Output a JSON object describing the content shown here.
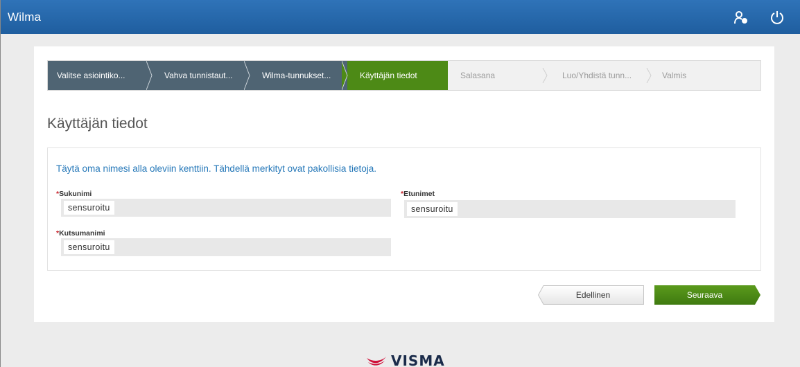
{
  "app": {
    "title": "Wilma"
  },
  "topbar": {
    "user_icon": "user-settings-icon",
    "power_icon": "power-icon"
  },
  "stepper": {
    "steps": [
      {
        "label": "Valitse asiointiko...",
        "state": "done"
      },
      {
        "label": "Vahva tunnistaut...",
        "state": "done"
      },
      {
        "label": "Wilma-tunnukset...",
        "state": "done"
      },
      {
        "label": "Käyttäjän tiedot",
        "state": "active"
      },
      {
        "label": "Salasana",
        "state": "todo"
      },
      {
        "label": "Luo/Yhdistä tunn...",
        "state": "todo"
      },
      {
        "label": "Valmis",
        "state": "todo"
      }
    ]
  },
  "page": {
    "title": "Käyttäjän tiedot",
    "instruction": "Täytä oma nimesi alla oleviin kenttiin. Tähdellä merkityt ovat pakollisia tietoja."
  },
  "form": {
    "required_mark": "*",
    "sukunimi": {
      "label": "Sukunimi",
      "value": "sensuroitu"
    },
    "etunimet": {
      "label": "Etunimet",
      "value": "sensuroitu"
    },
    "kutsumanimi": {
      "label": "Kutsumanimi",
      "value": "sensuroitu"
    }
  },
  "buttons": {
    "previous": "Edellinen",
    "next": "Seuraava"
  },
  "footer": {
    "logo_text": "VISMA"
  },
  "colors": {
    "topbar": "#2f73b8",
    "step_done": "#4f6473",
    "step_active": "#4d8a16",
    "instruction": "#2477b8",
    "required": "#c8222b",
    "visma_red": "#d0103a"
  }
}
